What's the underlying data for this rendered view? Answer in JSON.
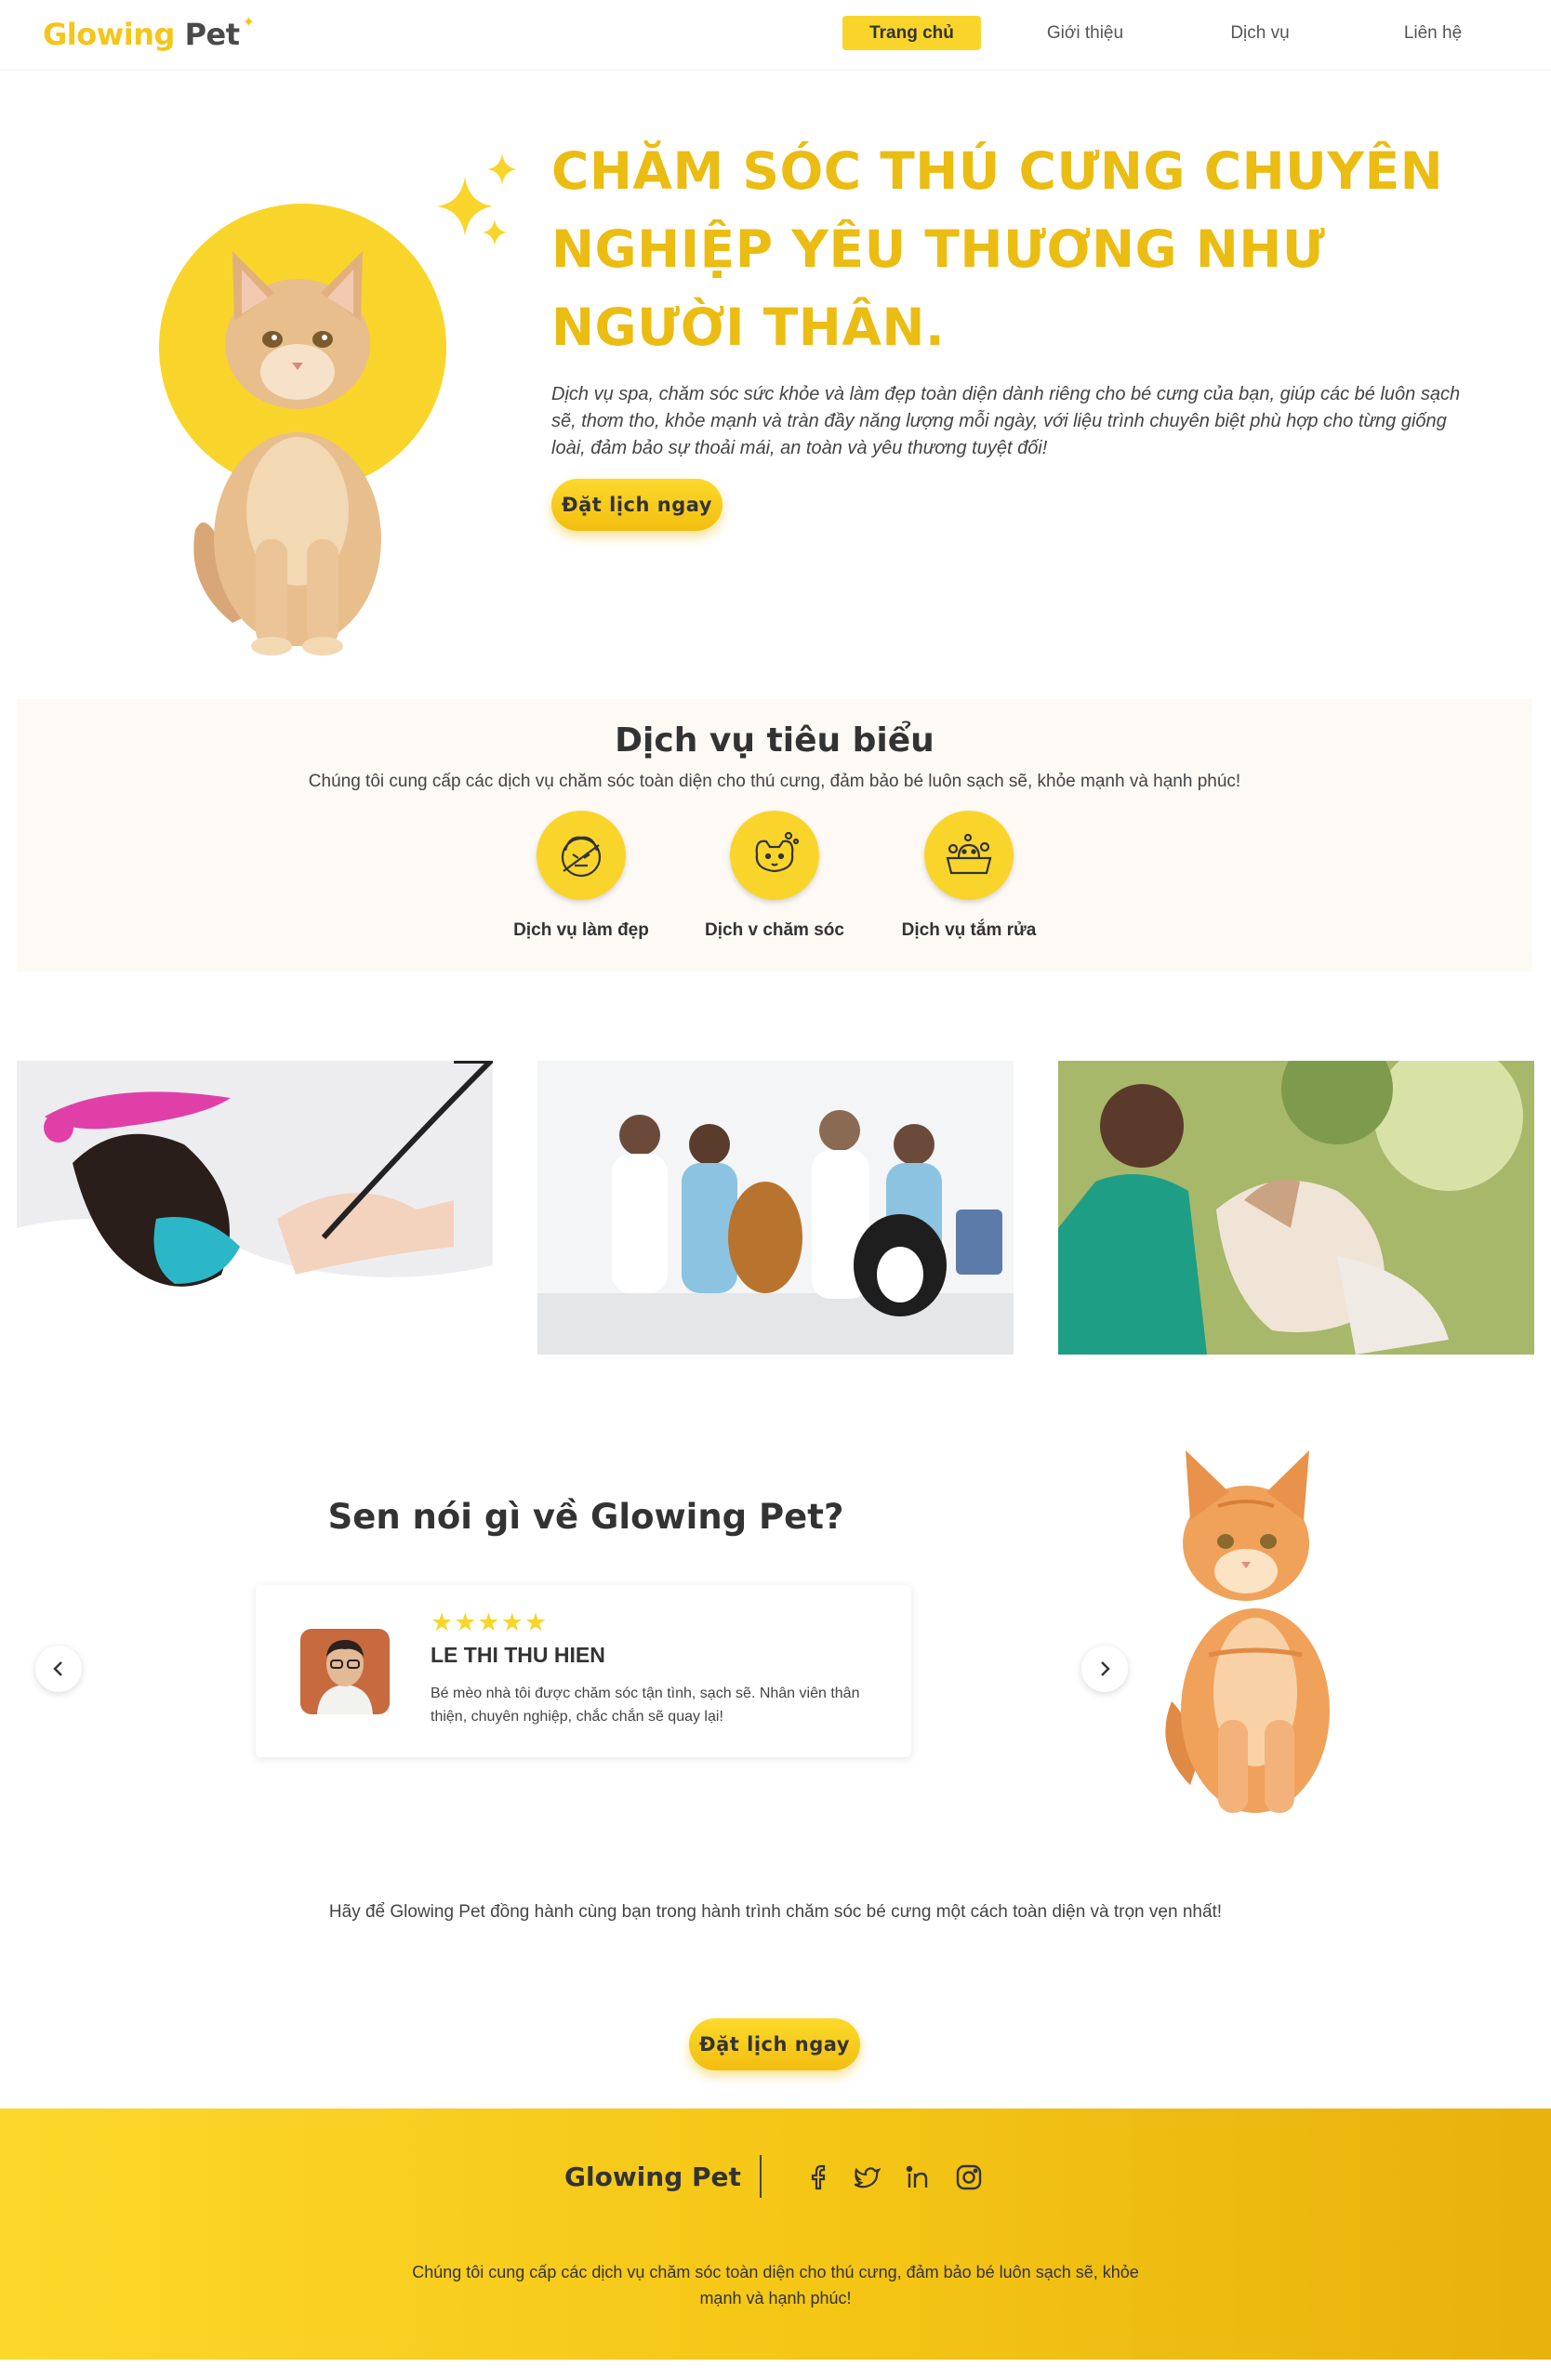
{
  "header": {
    "logo_main": "Glowing",
    "logo_accent": "Pet",
    "nav": [
      {
        "label": "Trang chủ"
      },
      {
        "label": "Giới thiệu"
      },
      {
        "label": "Dịch vụ"
      },
      {
        "label": "Liên hệ"
      }
    ]
  },
  "hero": {
    "title": "CHĂM SÓC THÚ CƯNG CHUYÊN NGHIỆP YÊU THƯƠNG NHƯ NGƯỜI THÂN.",
    "description": "Dịch vụ spa, chăm sóc sức khỏe và làm đẹp toàn diện dành riêng cho bé cưng của bạn, giúp các bé luôn sạch sẽ, thơm tho, khỏe mạnh và tràn đầy năng lượng mỗi ngày, với liệu trình chuyên biệt phù hợp cho từng giống loài, đảm bảo sự thoải mái, an toàn và yêu thương tuyệt đối!",
    "cta": "Đặt lịch ngay"
  },
  "services": {
    "title": "Dịch vụ tiêu biểu",
    "subtitle": "Chúng tôi cung cấp các dịch vụ chăm sóc toàn diện cho thú cưng, đảm bảo bé luôn sạch sẽ, khỏe mạnh và hạnh phúc!",
    "items": [
      {
        "label": "Dịch vụ làm đẹp",
        "icon": "grooming-icon"
      },
      {
        "label": "Dịch v chăm sóc",
        "icon": "pet-care-icon"
      },
      {
        "label": "Dịch vụ tắm rửa",
        "icon": "bathing-icon"
      }
    ]
  },
  "testimonials": {
    "title": "Sen nói gì về Glowing Pet?",
    "rating": 5,
    "stars": "★★★★★",
    "name": "LE THI THU HIEN",
    "text": "Bé mèo nhà tôi được chăm sóc tận tình, sạch sẽ. Nhân viên thân thiện, chuyên nghiệp, chắc chắn sẽ quay lại!"
  },
  "cta_section": {
    "text": "Hãy để Glowing Pet đồng hành cùng bạn trong hành trình chăm sóc bé cưng một cách toàn diện và trọn vẹn nhất!",
    "button": "Đặt lịch ngay"
  },
  "footer": {
    "brand": "Glowing Pet",
    "socials": [
      "facebook-icon",
      "twitter-icon",
      "linkedin-icon",
      "instagram-icon"
    ],
    "description": "Chúng tôi cung cấp các dịch vụ chăm sóc toàn diện cho thú cưng, đảm bảo bé luôn sạch sẽ, khỏe mạnh và hạnh phúc!"
  },
  "colors": {
    "accent": "#F9D52B",
    "title": "#EBBC12",
    "text": "#333333"
  }
}
